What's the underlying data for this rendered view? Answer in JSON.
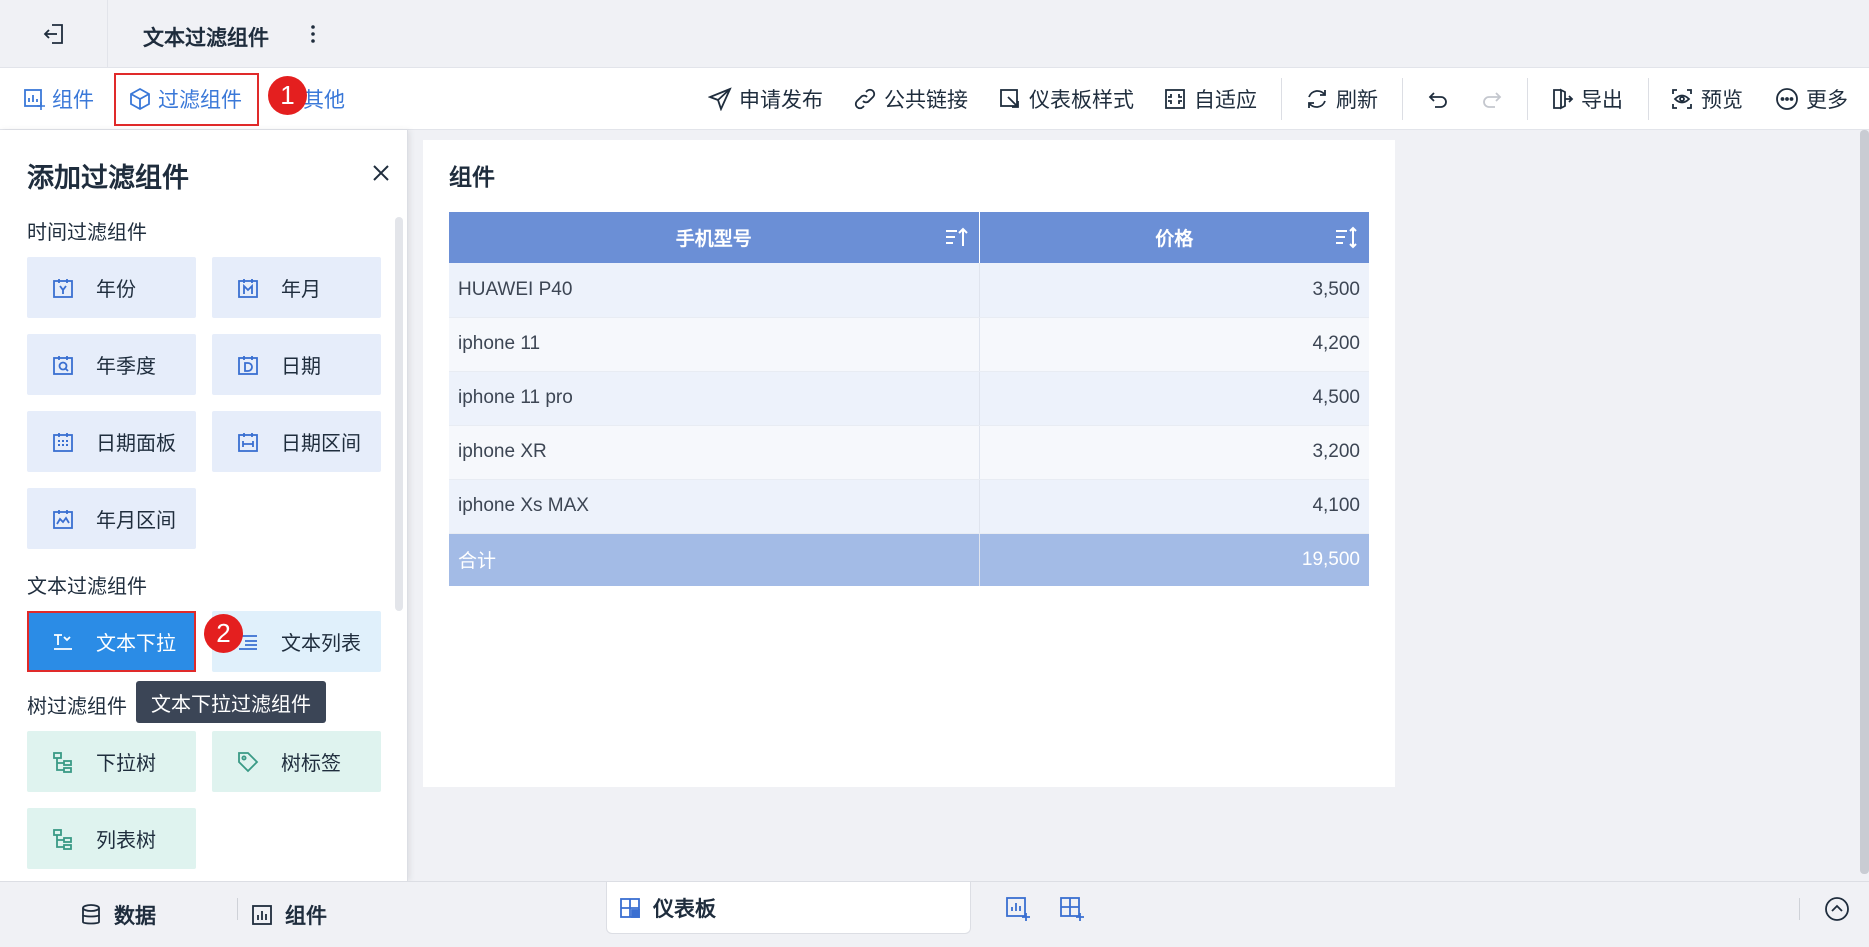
{
  "titlebar": {
    "title": "文本过滤组件"
  },
  "toolbar": {
    "components_label": "组件",
    "filter_components_label": "过滤组件",
    "other_label": "其他",
    "badge_1": "1",
    "publish_label": "申请发布",
    "public_link_label": "公共链接",
    "dashboard_style_label": "仪表板样式",
    "adaptive_label": "自适应",
    "refresh_label": "刷新",
    "export_label": "导出",
    "preview_label": "预览",
    "more_label": "更多"
  },
  "panel": {
    "title": "添加过滤组件",
    "time_section": "时间过滤组件",
    "time_items": [
      "年份",
      "年月",
      "年季度",
      "日期",
      "日期面板",
      "日期区间",
      "年月区间"
    ],
    "text_section": "文本过滤组件",
    "text_items": [
      "文本下拉",
      "文本列表"
    ],
    "badge_2": "2",
    "tooltip": "文本下拉过滤组件",
    "tree_section": "树过滤组件",
    "tree_items": [
      "下拉树",
      "树标签",
      "列表树"
    ]
  },
  "widget": {
    "title": "组件",
    "columns": [
      "手机型号",
      "价格"
    ],
    "rows": [
      [
        "HUAWEI P40",
        "3,500"
      ],
      [
        "iphone 11",
        "4,200"
      ],
      [
        "iphone 11 pro",
        "4,500"
      ],
      [
        "iphone XR",
        "3,200"
      ],
      [
        "iphone Xs MAX",
        "4,100"
      ]
    ],
    "total": [
      "合计",
      "19,500"
    ]
  },
  "bottombar": {
    "data_tab": "数据",
    "components_tab": "组件",
    "dashboard_tab": "仪表板"
  },
  "colors": {
    "accent": "#3a78d8",
    "header_blue": "#6b8fd6",
    "active_button": "#2b8ce6",
    "highlight_red": "#e02a2a"
  }
}
